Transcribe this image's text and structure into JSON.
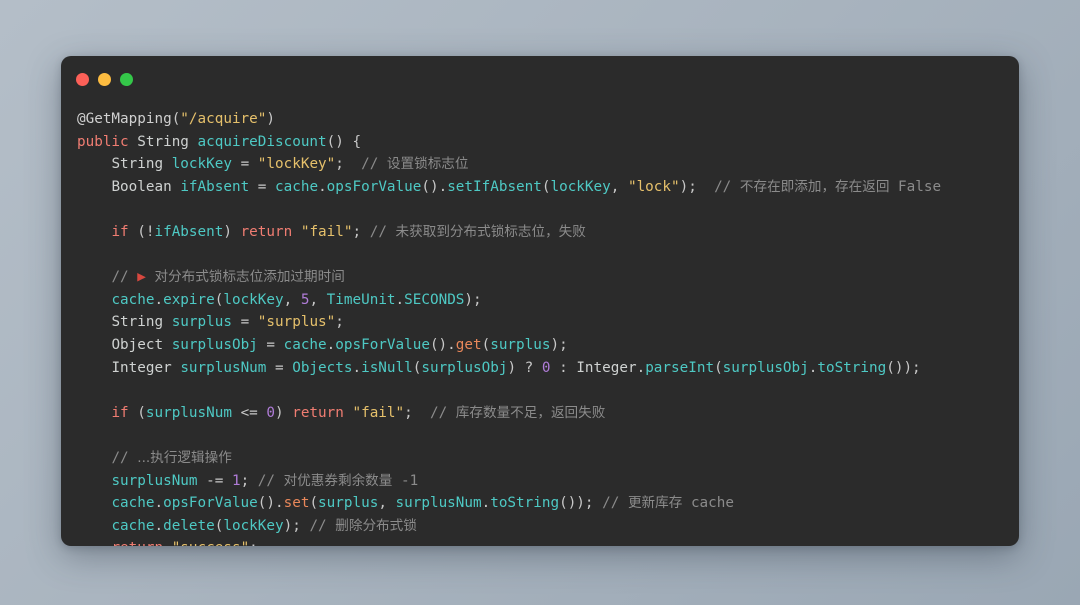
{
  "window": {
    "traffic_lights": [
      {
        "name": "close",
        "color": "#fc6058"
      },
      {
        "name": "minimize",
        "color": "#fdbc40"
      },
      {
        "name": "zoom",
        "color": "#34c749"
      }
    ],
    "background_color": "#2b2b2b",
    "page_background_color": "#aeb8c2"
  },
  "theme": {
    "keyword": "#f07d72",
    "type": "#cfd2d1",
    "variable": "#4ec9c4",
    "method": "#4ec9c4",
    "method_warm": "#e8875a",
    "string": "#e5c06b",
    "number": "#b07cd8",
    "comment": "#8b8b8b",
    "operator": "#c8c8c8",
    "foreground": "#d0d0d0"
  },
  "code": {
    "language": "java",
    "lines": [
      "@GetMapping(\"/acquire\")",
      "public String acquireDiscount() {",
      "    String lockKey = \"lockKey\";  // 设置锁标志位",
      "    Boolean ifAbsent = cache.opsForValue().setIfAbsent(lockKey, \"lock\");  // 不存在即添加，存在返回 False",
      "",
      "    if (!ifAbsent) return \"fail\"; // 未获取到分布式锁标志位，失败",
      "",
      "    // 🚩 对分布式锁标志位添加过期时间",
      "    cache.expire(lockKey, 5, TimeUnit.SECONDS);",
      "    String surplus = \"surplus\";",
      "    Object surplusObj = cache.opsForValue().get(surplus);",
      "    Integer surplusNum = Objects.isNull(surplusObj) ? 0 : Integer.parseInt(surplusObj.toString());",
      "",
      "    if (surplusNum <= 0) return \"fail\";  // 库存数量不足，返回失败",
      "",
      "    // ...执行逻辑操作",
      "    surplusNum -= 1; // 对优惠券剩余数量 -1",
      "    cache.opsForValue().set(surplus, surplusNum.toString()); // 更新库存 cache",
      "    cache.delete(lockKey); // 删除分布式锁",
      "    return \"success\";",
      "}"
    ],
    "comments": [
      "设置锁标志位",
      "不存在即添加，存在返回 False",
      "未获取到分布式锁标志位，失败",
      "对分布式锁标志位添加过期时间",
      "库存数量不足，返回失败",
      "...执行逻辑操作",
      "对优惠券剩余数量 -1",
      "更新库存 cache",
      "删除分布式锁"
    ],
    "strings": [
      "/acquire",
      "lockKey",
      "lock",
      "fail",
      "surplus",
      "fail",
      "success"
    ],
    "numbers": [
      "5",
      "0",
      "0",
      "1"
    ],
    "method_name": "acquireDiscount",
    "annotation": "@GetMapping"
  }
}
